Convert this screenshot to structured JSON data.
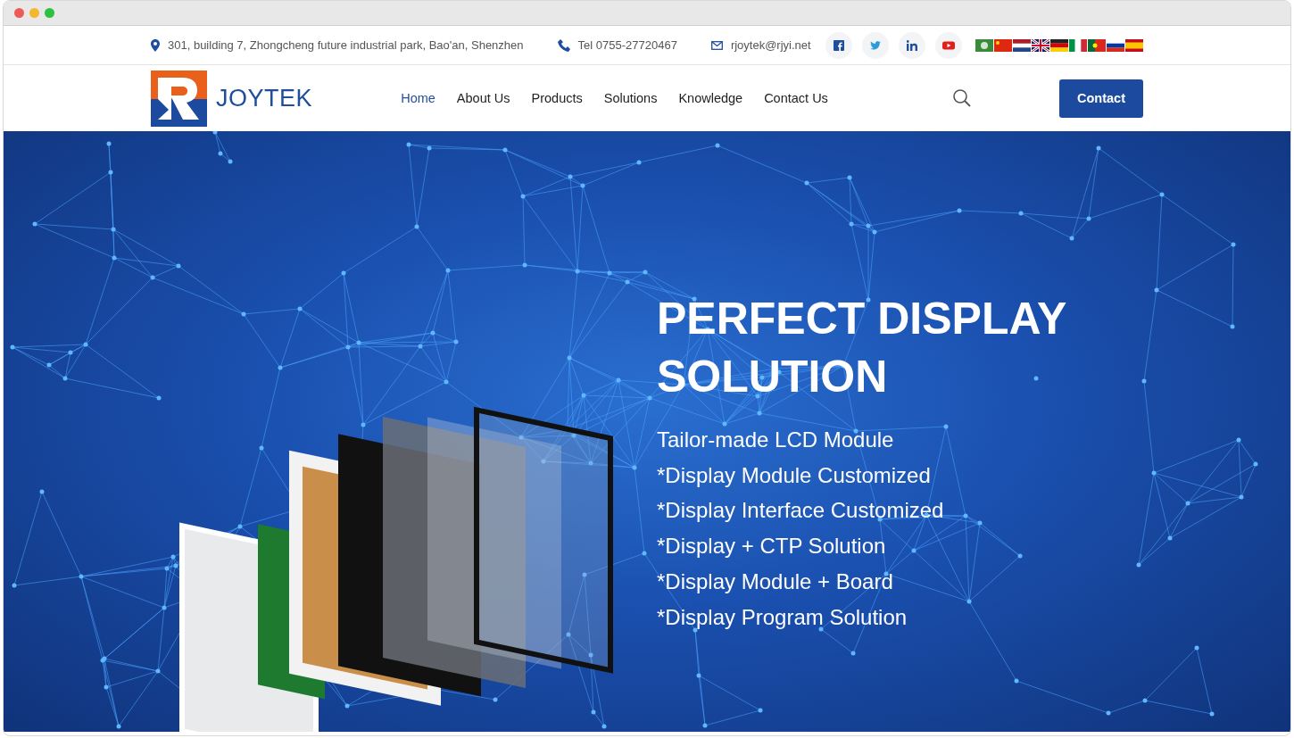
{
  "topbar": {
    "address": "301, building 7, Zhongcheng future industrial park, Bao'an, Shenzhen",
    "phone": "Tel 0755-27720467",
    "email": "rjoytek@rjyi.net"
  },
  "logo": {
    "text": "JOYTEK"
  },
  "nav": [
    {
      "label": "Home",
      "selected": true
    },
    {
      "label": "About Us",
      "selected": false
    },
    {
      "label": "Products",
      "selected": false
    },
    {
      "label": "Solutions",
      "selected": false
    },
    {
      "label": "Knowledge",
      "selected": false
    },
    {
      "label": "Contact Us",
      "selected": false
    }
  ],
  "contact_button": "Contact",
  "hero": {
    "title": "PERFECT DISPLAY SOLUTION",
    "lines": [
      "Tailor-made LCD Module",
      "*Display Module Customized",
      "*Display Interface Customized",
      "*Display + CTP Solution",
      "*Display Module + Board",
      "*Display Program Solution"
    ]
  }
}
